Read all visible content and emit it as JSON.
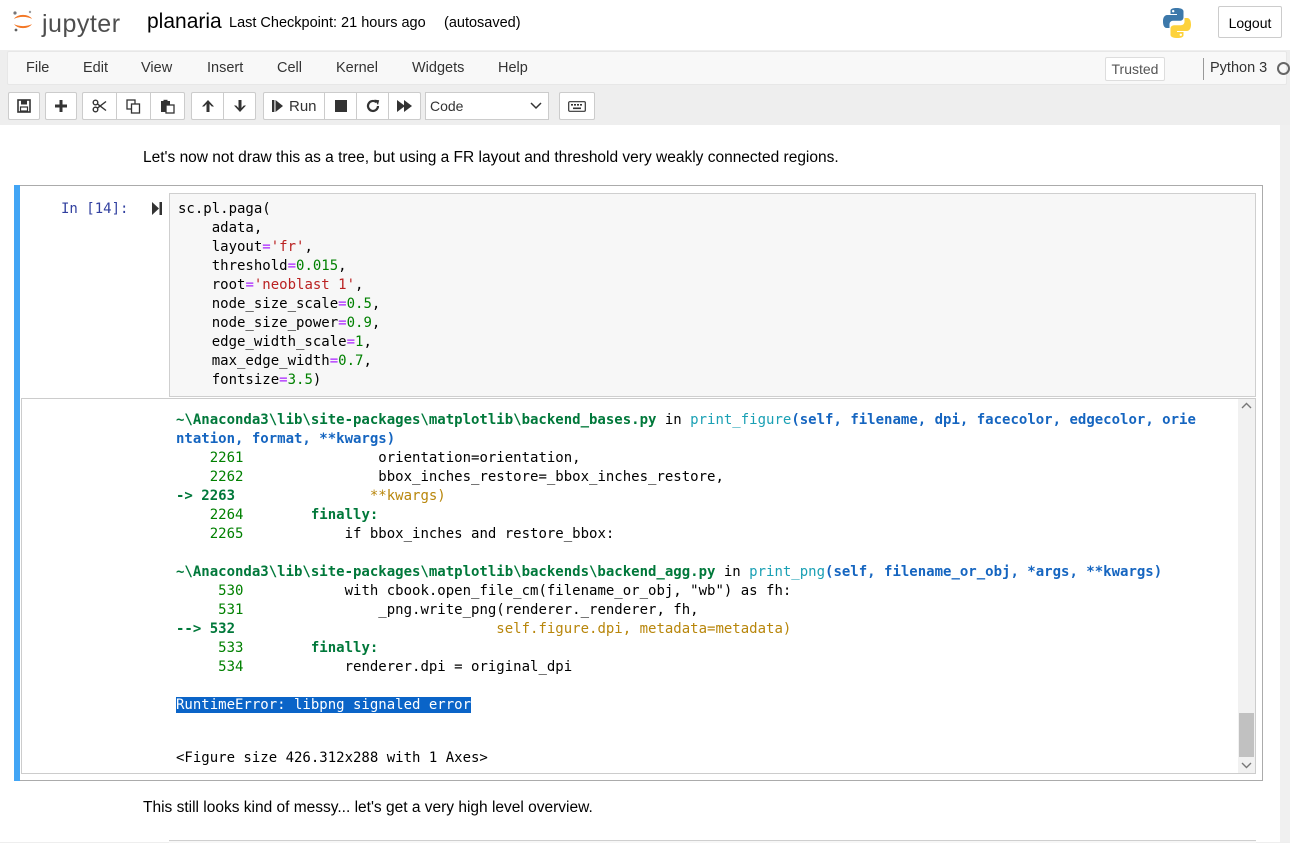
{
  "header": {
    "logo_text": "jupyter",
    "notebook_name": "planaria",
    "checkpoint": "Last Checkpoint: 21 hours ago",
    "autosave": "(autosaved)",
    "logout_label": "Logout"
  },
  "menubar": {
    "items": [
      "File",
      "Edit",
      "View",
      "Insert",
      "Cell",
      "Kernel",
      "Widgets",
      "Help"
    ],
    "trusted": "Trusted",
    "kernel": "Python 3"
  },
  "toolbar": {
    "run_label": "Run",
    "cell_type": "Code",
    "icons": [
      "save-icon",
      "plus-icon",
      "cut-icon",
      "copy-icon",
      "paste-icon",
      "arrow-up-icon",
      "arrow-down-icon",
      "run-icon",
      "stop-icon",
      "restart-icon",
      "fast-forward-icon",
      "keyboard-icon"
    ]
  },
  "notebook": {
    "md_top": "Let's now not draw this as a tree, but using a FR layout and threshold very weakly connected regions.",
    "prompt": "In [14]:",
    "code": {
      "l1": "sc.pl.paga(",
      "adata": "    adata,",
      "layout_key": "    layout",
      "layout_val": "'fr'",
      "threshold_key": "    threshold",
      "threshold_val": "0.015",
      "root_key": "    root",
      "root_val": "'neoblast 1'",
      "nss_key": "    node_size_scale",
      "nss_val": "0.5",
      "nsp_key": "    node_size_power",
      "nsp_val": "0.9",
      "ews_key": "    edge_width_scale",
      "ews_val": "1",
      "mew_key": "    max_edge_width",
      "mew_val": "0.7",
      "fs_key": "    fontsize",
      "fs_val": "3.5"
    },
    "traceback": {
      "f1_path": "~\\Anaconda3\\lib\\site-packages\\matplotlib\\backend_bases.py",
      "in": " in ",
      "f1_func": "print_figure",
      "f1_args": "(self, filename, dpi, facecolor, edgecolor, orie",
      "f1_args2": "ntation, format, **kwargs)",
      "l2261": "    2261",
      "c2261": "                orientation=orientation,",
      "l2262": "    2262",
      "c2262": "                bbox_inches_restore=_bbox_inches_restore,",
      "l2263": "-> 2263",
      "c2263": "                **kwargs)",
      "l2264": "    2264",
      "c2264": "        finally:",
      "l2265": "    2265",
      "c2265": "            if bbox_inches and restore_bbox:",
      "f2_path": "~\\Anaconda3\\lib\\site-packages\\matplotlib\\backends\\backend_agg.py",
      "f2_func": "print_png",
      "f2_args": "(self, filename_or_obj, *args, **kwargs)",
      "l530": "     530",
      "c530": "            with cbook.open_file_cm(filename_or_obj, \"wb\") as fh:",
      "l531": "     531",
      "c531": "                _png.write_png(renderer._renderer, fh,",
      "l532": "--> 532",
      "c532": "                               self.figure.dpi, metadata=metadata)",
      "l533": "     533",
      "c533": "        finally:",
      "l534": "     534",
      "c534": "            renderer.dpi = original_dpi",
      "error": "RuntimeError: libpng signaled error",
      "figure": "<Figure size 426.312x288 with 1 Axes>"
    },
    "md_bottom": "This still looks kind of messy... let's get a very high level overview."
  },
  "colors": {
    "cell_selected_bar": "#42a5f5",
    "prompt": "#303f9f",
    "selection": "#0a64c8"
  }
}
